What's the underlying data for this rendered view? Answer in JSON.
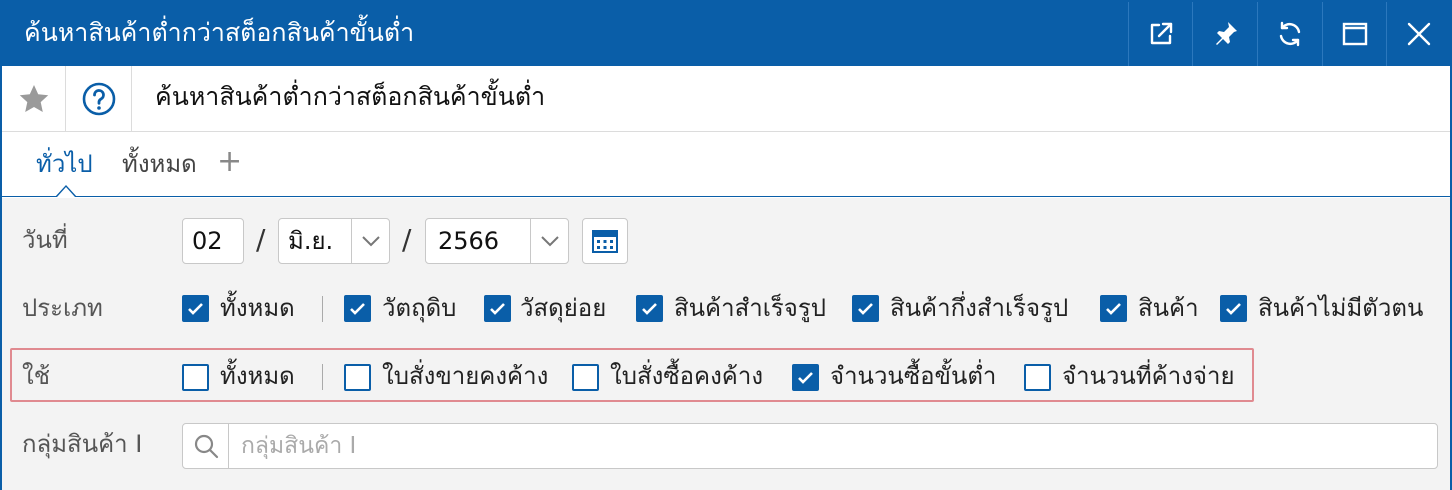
{
  "window": {
    "title": "ค้นหาสินค้าต่ำกว่าสต็อกสินค้าขั้นต่ำ",
    "controls": [
      "open-external-icon",
      "pin-icon",
      "refresh-icon",
      "maximize-icon",
      "close-icon"
    ],
    "accent_color": "#0a5ea8"
  },
  "header": {
    "page_title": "ค้นหาสินค้าต่ำกว่าสต็อกสินค้าขั้นต่ำ",
    "favorite_icon": "star-icon",
    "help_icon": "help-icon"
  },
  "tabs": [
    {
      "label": "ทั่วไป",
      "active": true
    },
    {
      "label": "ทั้งหมด",
      "active": false
    }
  ],
  "tab_add_label": "+",
  "form": {
    "date": {
      "label": "วันที่",
      "day": "02",
      "month": "มิ.ย.",
      "year": "2566",
      "separator": "/"
    },
    "type": {
      "label": "ประเภท",
      "options": [
        {
          "label": "ทั้งหมด",
          "checked": true
        },
        {
          "label": "วัตถุดิบ",
          "checked": true
        },
        {
          "label": "วัสดุย่อย",
          "checked": true
        },
        {
          "label": "สินค้าสำเร็จรูป",
          "checked": true
        },
        {
          "label": "สินค้ากึ่งสำเร็จรูป",
          "checked": true
        },
        {
          "label": "สินค้า",
          "checked": true
        },
        {
          "label": "สินค้าไม่มีตัวตน",
          "checked": true
        }
      ]
    },
    "use": {
      "label": "ใช้",
      "options": [
        {
          "label": "ทั้งหมด",
          "checked": false
        },
        {
          "label": "ใบสั่งขายคงค้าง",
          "checked": false
        },
        {
          "label": "ใบสั่งซื้อคงค้าง",
          "checked": false
        },
        {
          "label": "จำนวนซื้อขั้นต่ำ",
          "checked": true
        },
        {
          "label": "จำนวนที่ค้างจ่าย",
          "checked": false
        }
      ],
      "highlight_color": "#e08a90"
    },
    "group": {
      "label": "กลุ่มสินค้า I",
      "placeholder": "กลุ่มสินค้า I",
      "value": ""
    }
  }
}
